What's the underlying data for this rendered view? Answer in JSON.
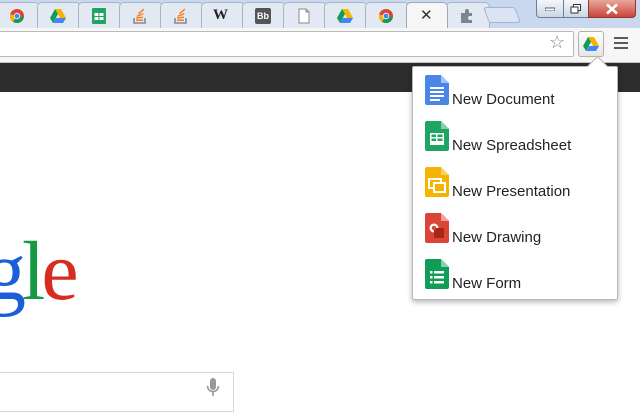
{
  "tabs": [
    {
      "icon": "chrome-icon"
    },
    {
      "icon": "drive-icon"
    },
    {
      "icon": "sheets-icon"
    },
    {
      "icon": "stackoverflow-icon"
    },
    {
      "icon": "stackoverflow-icon"
    },
    {
      "icon": "wikipedia-icon",
      "glyph": "W"
    },
    {
      "icon": "blackboard-icon",
      "glyph": "Bb"
    },
    {
      "icon": "blank-page-icon"
    },
    {
      "icon": "drive-icon"
    },
    {
      "icon": "chrome-icon"
    },
    {
      "icon": "close-icon",
      "glyph": "✕",
      "active": true
    },
    {
      "icon": "extension-icon"
    }
  ],
  "toolbar": {
    "bookmark_star_icon": "star-outline-icon",
    "bookmark_star_glyph": "☆",
    "extension_icon": "drive-icon",
    "menu_icon": "hamburger-menu-icon"
  },
  "page": {
    "logo_partial": {
      "g": "g",
      "l": "l",
      "e": "e"
    },
    "colors": {
      "g": "#1a5ed9",
      "l": "#139a43",
      "e": "#d62d20"
    }
  },
  "drive_menu": {
    "items": [
      {
        "label": "New Document",
        "icon": "docs-icon",
        "color": "#4a86e8"
      },
      {
        "label": "New Spreadsheet",
        "icon": "sheets-icon",
        "color": "#1fa463"
      },
      {
        "label": "New Presentation",
        "icon": "slides-icon",
        "color": "#f4b400"
      },
      {
        "label": "New Drawing",
        "icon": "drawings-icon",
        "color": "#db4437"
      },
      {
        "label": "New Form",
        "icon": "forms-icon",
        "color": "#0f9d58"
      }
    ]
  }
}
